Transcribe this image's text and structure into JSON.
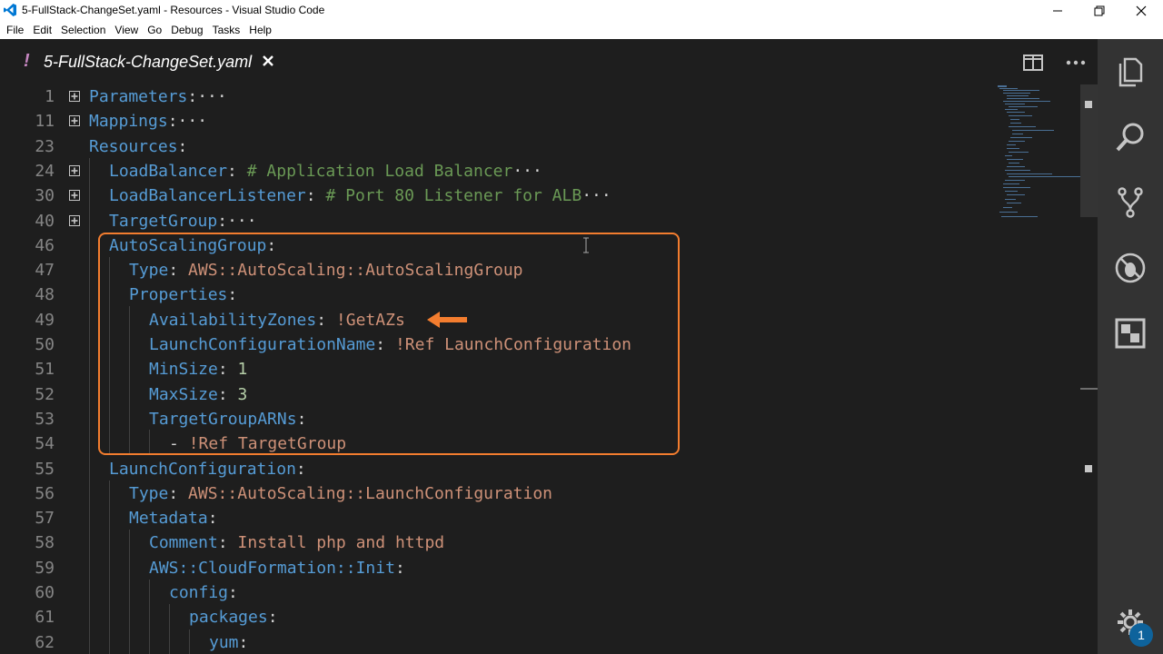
{
  "window": {
    "title": "5-FullStack-ChangeSet.yaml - Resources - Visual Studio Code",
    "app_icon": "vscode-logo-icon",
    "controls": [
      "minimize-icon",
      "restore-icon",
      "close-icon"
    ]
  },
  "menu": {
    "items": [
      "File",
      "Edit",
      "Selection",
      "View",
      "Go",
      "Debug",
      "Tasks",
      "Help"
    ]
  },
  "tab": {
    "modified_marker": "!",
    "label": "5-FullStack-ChangeSet.yaml",
    "close_icon": "close-icon",
    "actions": [
      "split-editor-icon",
      "more-actions-icon"
    ]
  },
  "editor": {
    "lines": [
      {
        "num": "1",
        "key": "Parameters",
        "sep": ":",
        "val": "",
        "val_class": "",
        "folded": true
      },
      {
        "num": "11",
        "key": "Mappings",
        "sep": ":",
        "val": "",
        "val_class": "",
        "folded": true
      },
      {
        "num": "23",
        "key": "Resources",
        "sep": ":",
        "val": "",
        "val_class": "",
        "folded": false
      },
      {
        "num": "24",
        "key": "LoadBalancer",
        "sep": ":",
        "val": "# Application Load Balancer",
        "val_class": "c",
        "folded": true
      },
      {
        "num": "30",
        "key": "LoadBalancerListener",
        "sep": ":",
        "val": "# Port 80 Listener for ALB",
        "val_class": "c",
        "folded": true
      },
      {
        "num": "40",
        "key": "TargetGroup",
        "sep": ":",
        "val": "",
        "val_class": "",
        "folded": true
      },
      {
        "num": "46",
        "key": "AutoScalingGroup",
        "sep": ":",
        "val": "",
        "val_class": "",
        "folded": false
      },
      {
        "num": "47",
        "key": "Type",
        "sep": ":",
        "val": "AWS::AutoScaling::AutoScalingGroup",
        "val_class": "s",
        "folded": false
      },
      {
        "num": "48",
        "key": "Properties",
        "sep": ":",
        "val": "",
        "val_class": "",
        "folded": false
      },
      {
        "num": "49",
        "key": "AvailabilityZones",
        "sep": ":",
        "val": "!GetAZs",
        "val_class": "s",
        "folded": false
      },
      {
        "num": "50",
        "key": "LaunchConfigurationName",
        "sep": ":",
        "val": "!Ref LaunchConfiguration",
        "val_class": "s",
        "folded": false
      },
      {
        "num": "51",
        "key": "MinSize",
        "sep": ":",
        "val": "1",
        "val_class": "n",
        "folded": false
      },
      {
        "num": "52",
        "key": "MaxSize",
        "sep": ":",
        "val": "3",
        "val_class": "n",
        "folded": false
      },
      {
        "num": "53",
        "key": "TargetGroupARNs",
        "sep": ":",
        "val": "",
        "val_class": "",
        "folded": false
      },
      {
        "num": "54",
        "key": "- ",
        "sep": "",
        "val": "!Ref TargetGroup",
        "val_class": "s",
        "folded": false
      },
      {
        "num": "55",
        "key": "LaunchConfiguration",
        "sep": ":",
        "val": "",
        "val_class": "",
        "folded": false
      },
      {
        "num": "56",
        "key": "Type",
        "sep": ":",
        "val": "AWS::AutoScaling::LaunchConfiguration",
        "val_class": "s",
        "folded": false
      },
      {
        "num": "57",
        "key": "Metadata",
        "sep": ":",
        "val": "",
        "val_class": "",
        "folded": false
      },
      {
        "num": "58",
        "key": "Comment",
        "sep": ":",
        "val": "Install php and httpd",
        "val_class": "s",
        "folded": false
      },
      {
        "num": "59",
        "key": "AWS::CloudFormation::Init",
        "sep": ":",
        "val": "",
        "val_class": "",
        "folded": false
      },
      {
        "num": "60",
        "key": "config",
        "sep": ":",
        "val": "",
        "val_class": "",
        "folded": false
      },
      {
        "num": "61",
        "key": "packages",
        "sep": ":",
        "val": "",
        "val_class": "",
        "folded": false
      },
      {
        "num": "62",
        "key": "yum",
        "sep": ":",
        "val": "",
        "val_class": "",
        "folded": false
      }
    ],
    "fold_ellipsis": "···"
  },
  "activity_bar": {
    "icons": [
      "explorer-icon",
      "search-icon",
      "source-control-icon",
      "debug-icon",
      "extensions-icon",
      "settings-gear-icon"
    ],
    "settings_badge": "1"
  },
  "colors": {
    "highlight_box": "#f37d2f",
    "key": "#569cd6",
    "string": "#ce9178",
    "number": "#b5cea8",
    "comment": "#6a9955"
  }
}
